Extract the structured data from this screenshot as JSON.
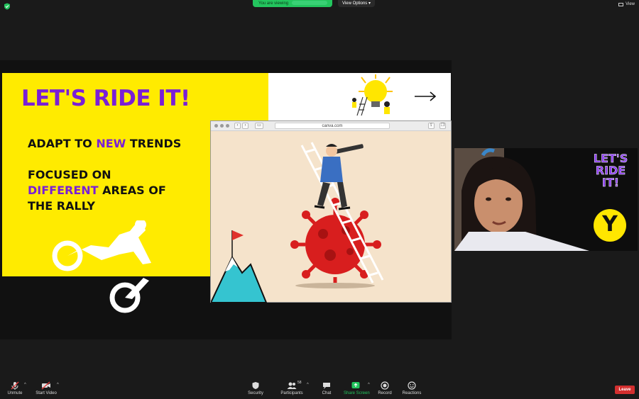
{
  "top_bar": {
    "shield_icon": "shield-check-icon",
    "viewing_label": "You are viewing",
    "view_options_label": "View Options",
    "view_label": "View"
  },
  "slide": {
    "title": "LET'S RIDE IT!",
    "bullet1_pre": "ADAPT TO ",
    "bullet1_hl": "NEW",
    "bullet1_post": " TRENDS",
    "bullet2_line1": "FOCUSED ON",
    "bullet2_hl": "DIFFERENT",
    "bullet2_line2_post": " AREAS OF",
    "bullet2_line3": "THE RALLY",
    "accent_color": "#7a1fd6",
    "background_color": "#ffeb00"
  },
  "browser": {
    "url": "canva.com"
  },
  "webcam": {
    "badge_text": "LET'S RIDE IT!",
    "logo_letter": "Y"
  },
  "toolbar": {
    "unmute": "Unmute",
    "start_video": "Start Video",
    "security": "Security",
    "participants": "Participants",
    "participants_count": "58",
    "chat": "Chat",
    "share_screen": "Share Screen",
    "record": "Record",
    "reactions": "Reactions",
    "leave": "Leave",
    "leave_color": "#d32f2f",
    "share_color": "#23c55e"
  }
}
